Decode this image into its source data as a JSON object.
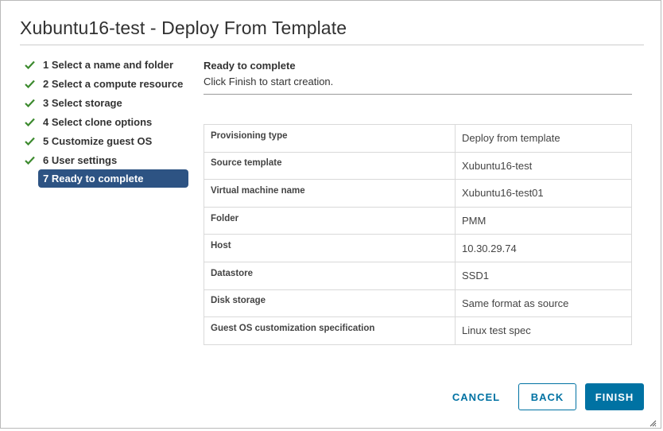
{
  "dialog": {
    "title": "Xubuntu16-test - Deploy From Template"
  },
  "steps": [
    {
      "label": "1 Select a name and folder",
      "done": true
    },
    {
      "label": "2 Select a compute resource",
      "done": true
    },
    {
      "label": "3 Select storage",
      "done": true
    },
    {
      "label": "4 Select clone options",
      "done": true
    },
    {
      "label": "5 Customize guest OS",
      "done": true
    },
    {
      "label": "6 User settings",
      "done": true
    },
    {
      "label": "7 Ready to complete",
      "active": true
    }
  ],
  "main": {
    "heading": "Ready to complete",
    "subheading": "Click Finish to start creation.",
    "summary": [
      {
        "key": "Provisioning type",
        "value": "Deploy from template"
      },
      {
        "key": "Source template",
        "value": "Xubuntu16-test"
      },
      {
        "key": "Virtual machine name",
        "value": "Xubuntu16-test01"
      },
      {
        "key": "Folder",
        "value": "PMM"
      },
      {
        "key": "Host",
        "value": "10.30.29.74"
      },
      {
        "key": "Datastore",
        "value": "SSD1"
      },
      {
        "key": "Disk storage",
        "value": "Same format as source"
      },
      {
        "key": "Guest OS customization specification",
        "value": "Linux test spec"
      }
    ]
  },
  "footer": {
    "cancel_label": "CANCEL",
    "back_label": "BACK",
    "finish_label": "FINISH"
  },
  "icons": {
    "step_done": "check-icon",
    "resize": "resize-grip-icon"
  },
  "colors": {
    "check": "#3c8a2e",
    "active_step_bg": "#2d5383",
    "primary": "#0072a3"
  }
}
